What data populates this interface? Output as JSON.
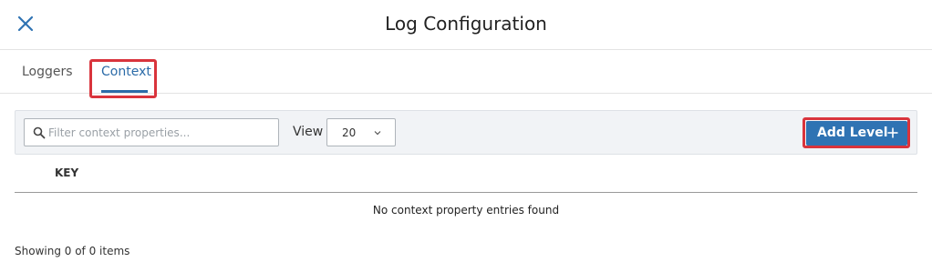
{
  "header": {
    "title": "Log Configuration",
    "close_icon": "close-icon"
  },
  "tabs": [
    {
      "label": "Loggers",
      "active": false
    },
    {
      "label": "Context",
      "active": true
    }
  ],
  "toolbar": {
    "search": {
      "placeholder": "Filter context properties...",
      "value": "",
      "icon": "search-icon"
    },
    "view_label": "View",
    "view_value": "20",
    "add_button_label": "Add Level",
    "add_button_icon": "plus-icon"
  },
  "table": {
    "columns": [
      "KEY"
    ],
    "rows": [],
    "empty_message": "No context property entries found"
  },
  "footer": {
    "status": "Showing 0 of 0 items"
  },
  "colors": {
    "accent": "#2f73b3",
    "tab_active": "#2b6ba8",
    "highlight": "#d9343c"
  }
}
